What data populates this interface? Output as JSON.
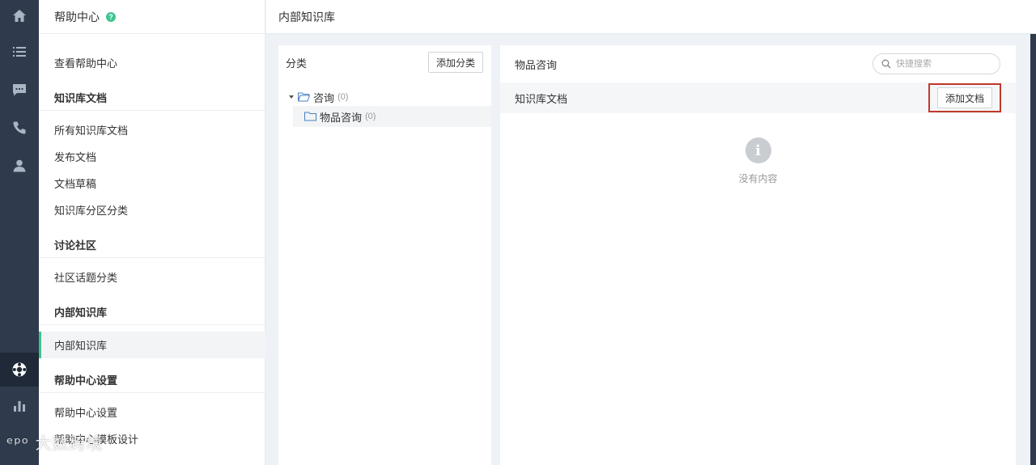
{
  "rail": {
    "items": [
      {
        "icon": "home-icon"
      },
      {
        "icon": "list-icon"
      },
      {
        "icon": "chat-icon"
      },
      {
        "icon": "phone-icon"
      },
      {
        "icon": "user-icon"
      },
      {
        "icon": "lifebuoy-icon",
        "active": true
      },
      {
        "icon": "bar-chart-icon"
      }
    ]
  },
  "sidebar": {
    "title": "帮助中心",
    "help_badge": "?",
    "view_help_center": "查看帮助中心",
    "sections": {
      "kb_docs": {
        "title": "知识库文档",
        "items": [
          "所有知识库文档",
          "发布文档",
          "文档草稿",
          "知识库分区分类"
        ]
      },
      "community": {
        "title": "讨论社区",
        "items": [
          "社区话题分类"
        ]
      },
      "internal_kb": {
        "title": "内部知识库",
        "items": [
          "内部知识库"
        ]
      },
      "settings": {
        "title": "帮助中心设置",
        "items": [
          "帮助中心设置",
          "帮助中心模板设计"
        ]
      }
    }
  },
  "topbar": {
    "title": "内部知识库"
  },
  "categories": {
    "title": "分类",
    "add_button": "添加分类",
    "tree": [
      {
        "label": "咨询",
        "count": "(0)",
        "expanded": true,
        "children": [
          {
            "label": "物品咨询",
            "count": "(0)"
          }
        ]
      }
    ]
  },
  "documents": {
    "title": "物品咨询",
    "search_placeholder": "快捷搜索",
    "list_title": "知识库文档",
    "add_button": "添加文档",
    "empty_icon": "i",
    "empty_text": "没有内容"
  },
  "watermark": "ᵉᵖᵒ 大数跨境"
}
